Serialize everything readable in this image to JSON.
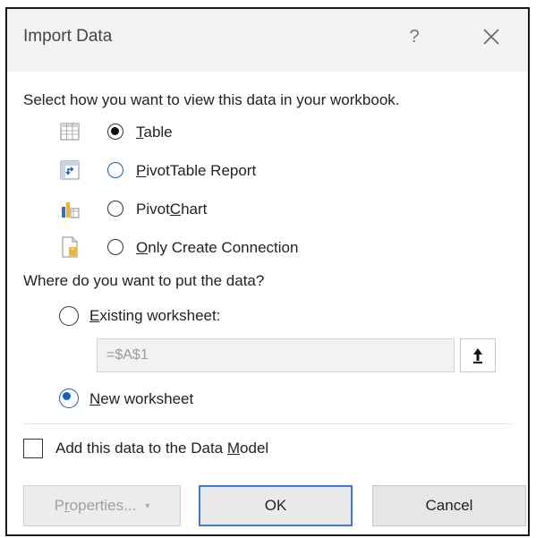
{
  "window": {
    "title": "Import Data",
    "help_glyph": "?"
  },
  "view_section": {
    "label": "Select how you want to view this data in your workbook.",
    "options": [
      {
        "pre": "",
        "accel": "T",
        "post": "able",
        "icon": "table-icon",
        "selected": true
      },
      {
        "pre": "",
        "accel": "P",
        "post": "ivotTable Report",
        "icon": "pivottable-icon",
        "selected": false
      },
      {
        "pre": "Pivot",
        "accel": "C",
        "post": "hart",
        "icon": "pivotchart-icon",
        "selected": false
      },
      {
        "pre": "",
        "accel": "O",
        "post": "nly Create Connection",
        "icon": "connection-icon",
        "selected": false
      }
    ]
  },
  "location_section": {
    "label": "Where do you want to put the data?",
    "existing": {
      "pre": "",
      "accel": "E",
      "post": "xisting worksheet:",
      "selected": false
    },
    "reference_value": "=$A$1",
    "new": {
      "pre": "",
      "accel": "N",
      "post": "ew worksheet",
      "selected": true
    }
  },
  "data_model": {
    "pre": "Add this data to the Data ",
    "accel": "M",
    "post": "odel",
    "checked": false
  },
  "buttons": {
    "properties": {
      "pre": "P",
      "accel": "r",
      "post": "operties...",
      "enabled": false
    },
    "ok": "OK",
    "cancel": "Cancel"
  },
  "colors": {
    "accent": "#1a5fb4",
    "default_button_border": "#3c7bd6",
    "titlebar": "#f3f3f3"
  }
}
